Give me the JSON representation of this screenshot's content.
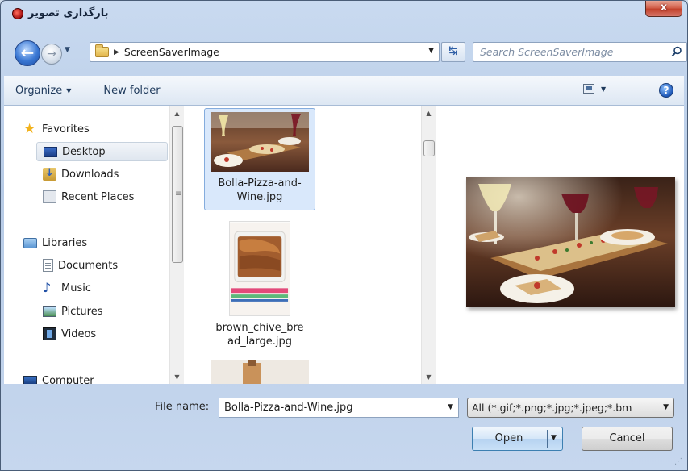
{
  "window": {
    "title": "بارگذاری تصویر",
    "close_label": "x"
  },
  "address": {
    "path": "ScreenSaverImage",
    "search_placeholder": "Search ScreenSaverImage"
  },
  "toolbar": {
    "organize": "Organize",
    "new_folder": "New folder",
    "help": "?"
  },
  "sidebar": {
    "items": [
      {
        "label": "Favorites",
        "icon": "star-icon"
      },
      {
        "label": "Desktop",
        "icon": "desktop-icon"
      },
      {
        "label": "Downloads",
        "icon": "downloads-icon"
      },
      {
        "label": "Recent Places",
        "icon": "recent-places-icon"
      },
      {
        "label": "Libraries",
        "icon": "libraries-icon"
      },
      {
        "label": "Documents",
        "icon": "documents-icon"
      },
      {
        "label": "Music",
        "icon": "music-icon"
      },
      {
        "label": "Pictures",
        "icon": "pictures-icon"
      },
      {
        "label": "Videos",
        "icon": "videos-icon"
      },
      {
        "label": "Computer",
        "icon": "computer-icon"
      }
    ]
  },
  "files": [
    {
      "name": "Bolla-Pizza-and-Wine.jpg",
      "line1": "Bolla-Pizza-and-",
      "line2": "Wine.jpg",
      "selected": true
    },
    {
      "name": "brown_chive_bread_large.jpg",
      "line1": "brown_chive_bre",
      "line2": "ad_large.jpg",
      "selected": false
    }
  ],
  "bottom": {
    "file_name_label_pre": "File ",
    "file_name_label_underlined": "n",
    "file_name_label_post": "ame:",
    "file_name_value": "Bolla-Pizza-and-Wine.jpg",
    "filter_value": "All (*.gif;*.png;*.jpg;*.jpeg;*.bm",
    "open_label": "Open",
    "cancel_label": "Cancel"
  },
  "colors": {
    "frame": "#c6d7ee",
    "selection": "#d9e8fb",
    "accent": "#3c7fb1"
  }
}
